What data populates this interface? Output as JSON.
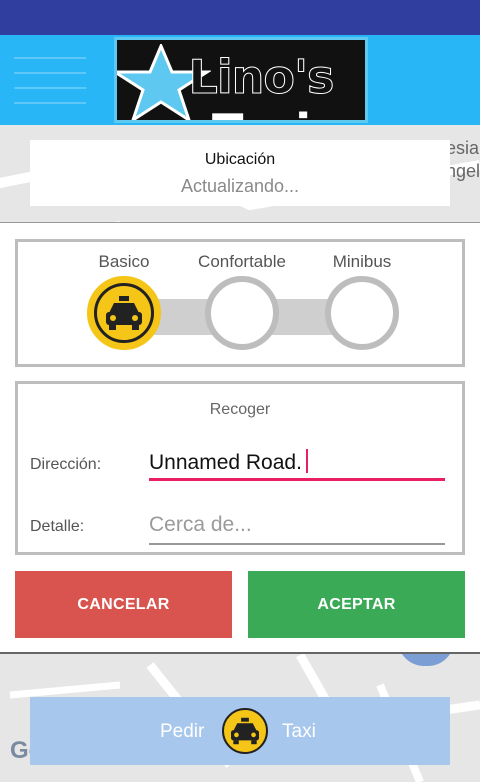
{
  "app": {
    "logo_text_part1": "Lino's",
    "logo_text_part2": "Taxi"
  },
  "toolbar": {
    "menu_icon": "hamburger-menu-icon"
  },
  "map": {
    "edge_text_line1": "esia",
    "edge_text_line2": "ngel",
    "google_watermark": "Google"
  },
  "location": {
    "title": "Ubicación",
    "value": "Actualizando..."
  },
  "categories": [
    {
      "label": "Basico",
      "selected": true,
      "icon": "taxi-icon"
    },
    {
      "label": "Confortable",
      "selected": false
    },
    {
      "label": "Minibus",
      "selected": false
    }
  ],
  "pickup": {
    "title": "Recoger",
    "address_label": "Dirección:",
    "address_value": "Unnamed Road.",
    "detail_label": "Detalle:",
    "detail_placeholder": "Cerca de..."
  },
  "actions": {
    "cancel": "CANCELAR",
    "accept": "ACEPTAR"
  },
  "order": {
    "left_text": "Pedir",
    "right_text": "Taxi",
    "icon": "taxi-icon"
  },
  "colors": {
    "status_bar": "#303f9f",
    "toolbar": "#29b6f6",
    "selected_category": "#f5c518",
    "cancel": "#d9534f",
    "accept": "#3aaa57",
    "focus_underline": "#e91e63",
    "order_button": "#a8c7ec"
  }
}
